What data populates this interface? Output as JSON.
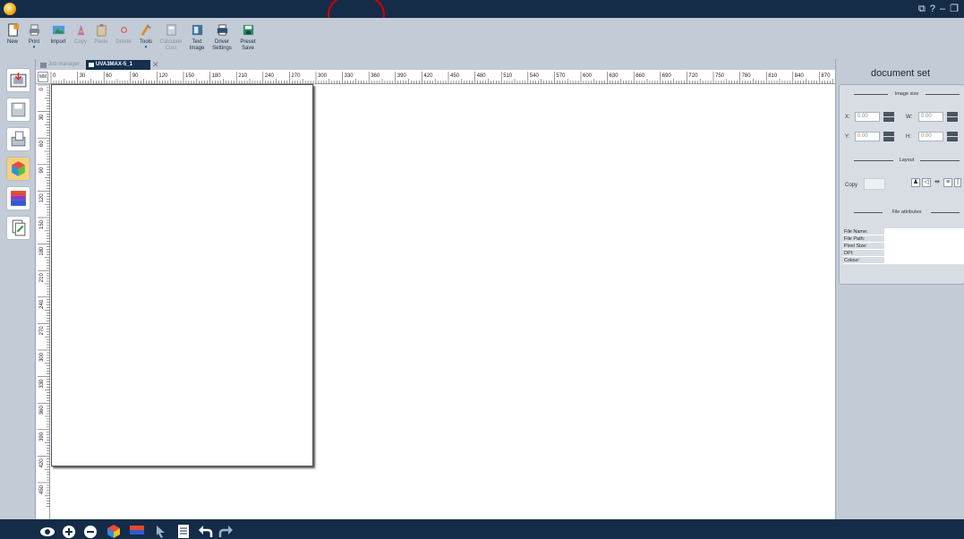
{
  "toolbar": {
    "items": [
      {
        "label": "New",
        "icon": "new-doc-icon"
      },
      {
        "label": "Print",
        "icon": "print-icon"
      },
      {
        "label": "Import",
        "icon": "import-icon"
      },
      {
        "label": "Copy",
        "icon": "copy-icon"
      },
      {
        "label": "Paste",
        "icon": "paste-icon"
      },
      {
        "label": "Delete",
        "icon": "delete-icon"
      },
      {
        "label": "Tools",
        "icon": "tools-icon"
      },
      {
        "label_line1": "Calculate",
        "label_line2": "Cost",
        "icon": "calculate-cost-icon"
      },
      {
        "label_line1": "Text",
        "label_line2": "Image",
        "icon": "text-image-icon"
      },
      {
        "label_line1": "Driver",
        "label_line2": "Settings",
        "icon": "driver-settings-icon"
      },
      {
        "label_line1": "Preset",
        "label_line2": "Save",
        "icon": "preset-save-icon"
      }
    ]
  },
  "tabs": {
    "job_manager": "Job manager",
    "document": "UVA3MAX-5_1",
    "close": "✕"
  },
  "ruler": {
    "unit": "MM",
    "top": [
      "0",
      "30",
      "60",
      "90",
      "120",
      "150",
      "180",
      "210",
      "240",
      "270",
      "300",
      "330",
      "360",
      "390",
      "420",
      "450",
      "480",
      "510",
      "540",
      "570",
      "600",
      "630",
      "660",
      "690",
      "720",
      "750",
      "780",
      "810",
      "840",
      "870"
    ],
    "left": [
      "0",
      "30",
      "60",
      "90",
      "120",
      "150",
      "180",
      "210",
      "240",
      "270",
      "300",
      "330",
      "360",
      "390",
      "420",
      "450"
    ]
  },
  "right_panel": {
    "title": "document set",
    "image_size": {
      "heading": "Image size",
      "x_label": "X:",
      "x": "0.00",
      "w_label": "W:",
      "w": "0.00",
      "y_label": "Y:",
      "y": "0.00",
      "h_label": "H:",
      "h": "0.00"
    },
    "layout": {
      "heading": "Layout",
      "copy_label": "Copy"
    },
    "file_attributes": {
      "heading": "File attributes",
      "rows": [
        "File Name:",
        "File Path:",
        "Pixel Size:",
        "DPI:",
        "Colour:"
      ]
    }
  },
  "colors": {
    "titlebar": "#152c48",
    "toolbar": "#c2cbd6",
    "annotation": "#d40000"
  }
}
